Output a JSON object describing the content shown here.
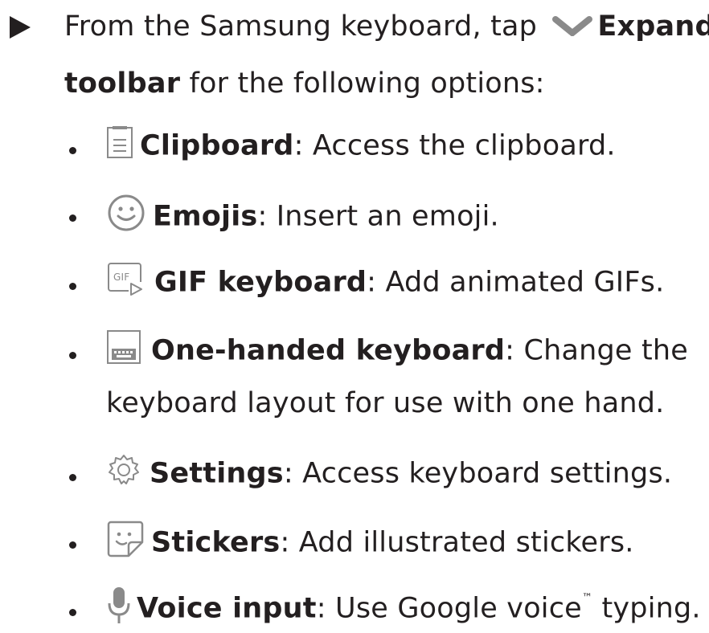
{
  "intro": {
    "line1_prefix": "From the Samsung keyboard, tap",
    "line1_bold": "Expand",
    "line2_bold": "toolbar",
    "line2_rest": " for the following options:"
  },
  "options": [
    {
      "icon": "clipboard-icon",
      "label": "Clipboard",
      "desc": ": Access the clipboard."
    },
    {
      "icon": "emoji-icon",
      "label": "Emojis",
      "desc": ": Insert an emoji."
    },
    {
      "icon": "gif-icon",
      "label": "GIF keyboard",
      "desc": ": Add animated GIFs."
    },
    {
      "icon": "one-handed-keyboard-icon",
      "label": "One-handed keyboard",
      "desc": ": Change the",
      "desc2": "keyboard layout for use with one hand."
    },
    {
      "icon": "gear-icon",
      "label": "Settings",
      "desc": ": Access keyboard settings."
    },
    {
      "icon": "sticker-icon",
      "label": "Stickers",
      "desc": ": Add illustrated stickers."
    },
    {
      "icon": "microphone-icon",
      "label": "Voice input",
      "desc": ": Use Google voice",
      "tm": "™",
      "desc_end": " typing."
    }
  ],
  "colors": {
    "text": "#231f20",
    "icon": "#8a8a8a"
  }
}
